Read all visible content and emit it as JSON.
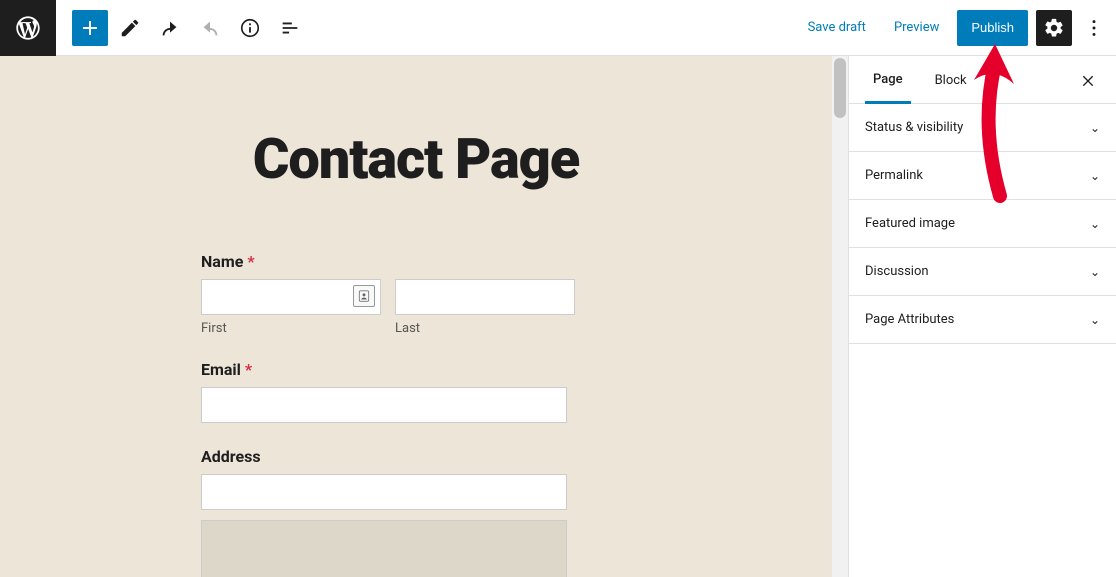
{
  "toolbar": {
    "save_draft": "Save draft",
    "preview": "Preview",
    "publish": "Publish"
  },
  "sidebar": {
    "tabs": {
      "page": "Page",
      "block": "Block"
    },
    "panels": {
      "status": "Status & visibility",
      "permalink": "Permalink",
      "featured_image": "Featured image",
      "discussion": "Discussion",
      "page_attributes": "Page Attributes"
    }
  },
  "editor": {
    "title": "Contact Page",
    "form": {
      "name_label": "Name",
      "first_sub": "First",
      "last_sub": "Last",
      "email_label": "Email",
      "address_label": "Address",
      "required_marker": "*"
    }
  }
}
